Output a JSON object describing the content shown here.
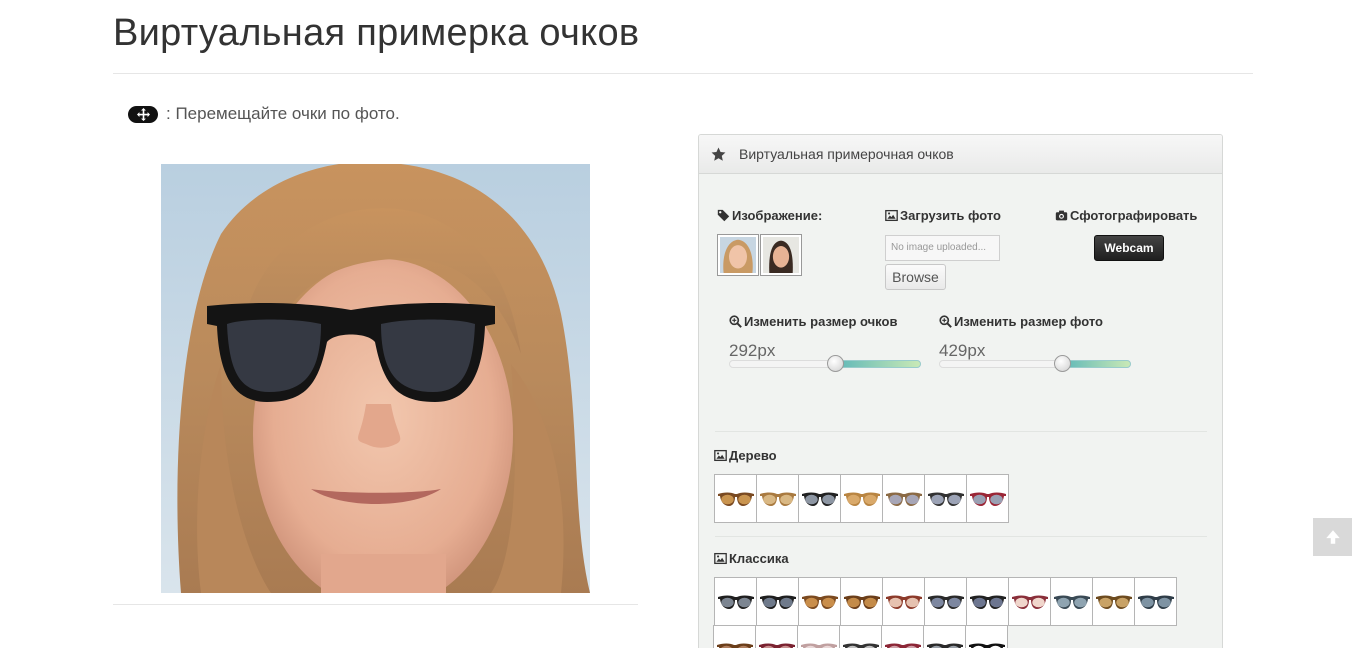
{
  "page": {
    "title": "Виртуальная примерка очков",
    "move_hint": ": Перемещайте очки по фото."
  },
  "panel": {
    "title": "Виртуальная примерочная очков",
    "image_label": "Изображение:",
    "upload_label": "Загрузить фото",
    "photo_label": "Сфотографировать",
    "file_placeholder": "No image uploaded...",
    "browse_label": "Browse",
    "webcam_label": "Webcam",
    "resize_glasses_label": "Изменить размер очков",
    "resize_glasses_value": "292px",
    "resize_glasses_level": 0.55,
    "resize_photo_label": "Изменить размер фото",
    "resize_photo_value": "429px",
    "resize_photo_level": 0.64
  },
  "models": [
    {
      "name": "woman-blonde"
    },
    {
      "name": "woman-dark-hair"
    }
  ],
  "categories": [
    {
      "label": "Дерево",
      "glasses": [
        {
          "frame": "#7a4a22",
          "lens": "#c9944f"
        },
        {
          "frame": "#a97a40",
          "lens": "#d9b884"
        },
        {
          "frame": "#222222",
          "lens": "#8d96a3"
        },
        {
          "frame": "#b98542",
          "lens": "#d9a96a"
        },
        {
          "frame": "#8b6a45",
          "lens": "#a7a6b7"
        },
        {
          "frame": "#333333",
          "lens": "#9ca3b6"
        },
        {
          "frame": "#9b2636",
          "lens": "#9aa0b3"
        }
      ]
    },
    {
      "label": "Классика",
      "glasses": [
        {
          "frame": "#1f1f1f",
          "lens": "#7c8591"
        },
        {
          "frame": "#1f1f1f",
          "lens": "#6f7a8b"
        },
        {
          "frame": "#7b4a20",
          "lens": "#c98e4b"
        },
        {
          "frame": "#6b3e1a",
          "lens": "#c48b49"
        },
        {
          "frame": "#8c3a2a",
          "lens": "#e6c2b0"
        },
        {
          "frame": "#2a2a2a",
          "lens": "#7d87a0"
        },
        {
          "frame": "#222222",
          "lens": "#6d7690"
        },
        {
          "frame": "#8a2f3a",
          "lens": "#f0d6cc"
        },
        {
          "frame": "#3a4a55",
          "lens": "#8fa4b1"
        },
        {
          "frame": "#6d4b1f",
          "lens": "#c8a266"
        },
        {
          "frame": "#2f3d48",
          "lens": "#7e93a3"
        },
        {
          "frame": "#6b3e1a",
          "lens": "#b08060"
        },
        {
          "frame": "#7a2230",
          "lens": "#c89090"
        },
        {
          "frame": "#c0a0a0",
          "lens": "#ead8d8"
        },
        {
          "frame": "#333333",
          "lens": "#c0c0c0"
        },
        {
          "frame": "#8c2636",
          "lens": "#d0a0a8"
        },
        {
          "frame": "#2a2a2a",
          "lens": "#9aa0a8"
        },
        {
          "frame": "#111111",
          "lens": "#ffffff"
        }
      ]
    }
  ],
  "colors": {
    "accent_slider": "#5fb8b8",
    "webcam_button": "#222222",
    "panel_bg": "#f1f3f1"
  }
}
